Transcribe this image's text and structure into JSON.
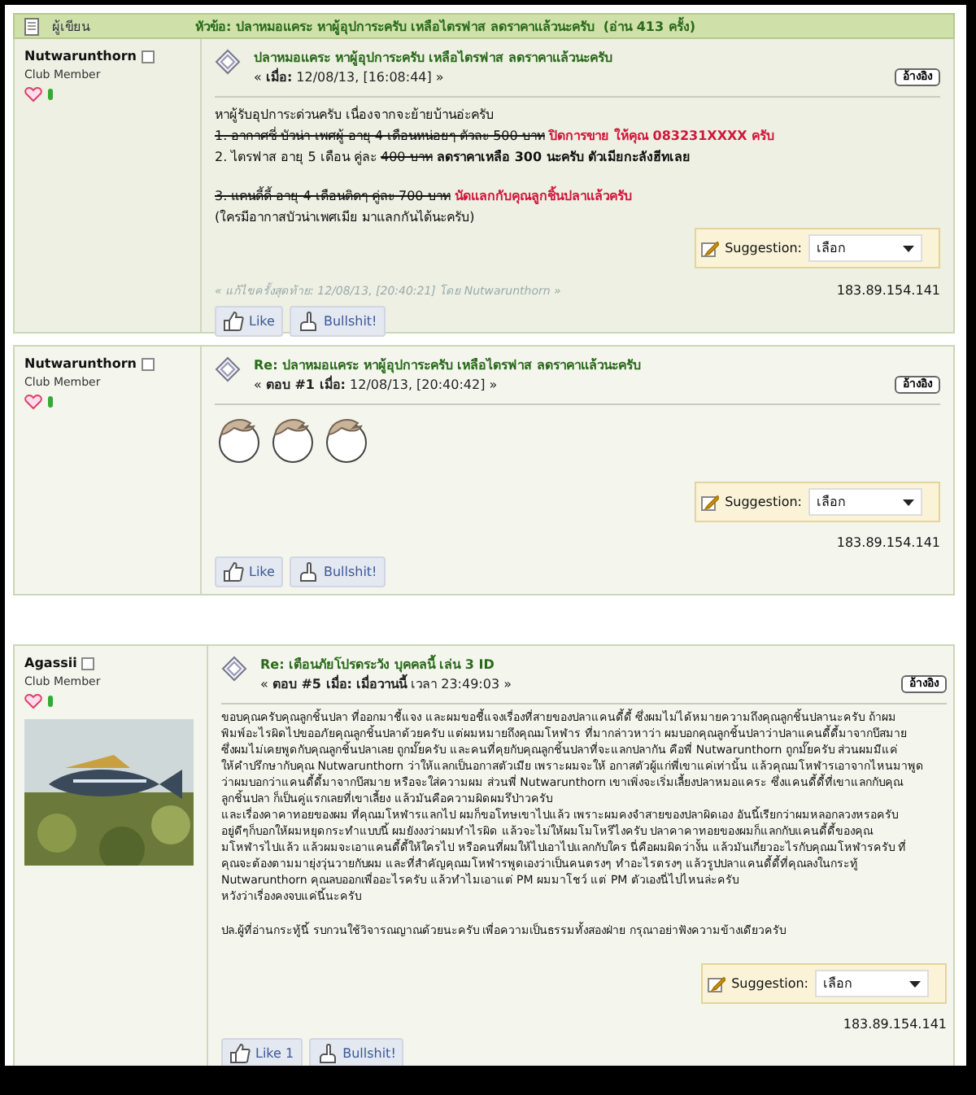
{
  "header": {
    "author_label": "ผู้เขียน",
    "topic": "หัวข้อ: ปลาหมอแคระ หาผู้อุปการะครับ เหลือไตรฟาส ลดราคาแล้วนะครับ  (อ่าน 413 ครั้ง)"
  },
  "posts": [
    {
      "author": "Nutwarunthorn",
      "rank": "Club Member",
      "title": "ปลาหมอแคระ หาผู้อุปการะครับ เหลือไตรฟาส ลดราคาแล้วนะครับ",
      "meta": "« **เมื่อ:** 12/08/13, [16:08:44] »",
      "quote_button": "อ้างอิง",
      "body": [
        {
          "kind": "text",
          "segments": [
            {
              "text": "หาผู้รับอุปการะด่วนครับ เนื่องจากจะย้ายบ้านอ่ะครับ",
              "kind": "plain"
            }
          ]
        },
        {
          "kind": "text",
          "segments": [
            {
              "text": "1. อากาศซี่ บัวน่า เพศผู้ อายุ 4 เดือนหน่อยๆ ตัวละ 500 บาท",
              "kind": "strike"
            },
            {
              "text": " ปิดการขาย ให้คุณ 083231XXXX ครับ",
              "kind": "red"
            }
          ]
        },
        {
          "kind": "text",
          "segments": [
            {
              "text": "2. ไตรฟาส อายุ 5 เดือน คู่ละ ",
              "kind": "plain"
            },
            {
              "text": "400 บาท",
              "kind": "strike"
            },
            {
              "text": " ลดราคาเหลือ 300 นะครับ ตัวเมียกะลังฮีทเลย",
              "kind": "bold"
            }
          ]
        },
        {
          "kind": "blank"
        },
        {
          "kind": "text",
          "segments": [
            {
              "text": "3. แคนดี้ดี้ อายุ 4 เดือนติดๆ คู่ละ 700 บาท",
              "kind": "strike"
            },
            {
              "text": " นัดแลกกับคุณลูกชิ้นปลาแล้วครับ",
              "kind": "red"
            }
          ]
        },
        {
          "kind": "text",
          "segments": [
            {
              "text": "(ใครมีอากาสบัวน่าเพศเมีย มาแลกกันได้นะครับ)",
              "kind": "plain"
            }
          ]
        }
      ],
      "suggestion": {
        "label": "Suggestion:",
        "value": "เลือก"
      },
      "ip": "183.89.154.141",
      "edit_note": "« แก้ไขครั้งสุดท้าย: 12/08/13, [20:40:21] โดย Nutwarunthorn »",
      "buttons": [
        {
          "kind": "like",
          "label": "Like"
        },
        {
          "kind": "bullshit",
          "label": "Bullshit!"
        }
      ]
    },
    {
      "author": "Nutwarunthorn",
      "rank": "Club Member",
      "title": "Re: ปลาหมอแคระ หาผู้อุปการะครับ เหลือไตรฟาส ลดราคาแล้วนะครับ",
      "meta": "« **ตอบ #1 เมื่อ:** 12/08/13, [20:40:42] »",
      "quote_button": "อ้างอิง",
      "body": [
        {
          "kind": "emoticon"
        },
        {
          "kind": "emoticon"
        },
        {
          "kind": "emoticon"
        }
      ],
      "suggestion": {
        "label": "Suggestion:",
        "value": "เลือก"
      },
      "ip": "183.89.154.141",
      "buttons": [
        {
          "kind": "like",
          "label": "Like"
        },
        {
          "kind": "bullshit",
          "label": "Bullshit!"
        }
      ]
    },
    {
      "author": "Agassii",
      "rank": "Club Member",
      "avatar": {
        "kind": "picture"
      },
      "title": "Re: เตือนภัยโปรดระวัง บุคคลนี้ เล่น 3 ID",
      "meta": "« **ตอบ #5 เมื่อ:** **เมื่อวานนี้** เวลา 23:49:03 »",
      "quote_button": "อ้างอิง",
      "body": [
        {
          "kind": "text",
          "segments": [
            {
              "text": "ขอบคุณครับคุณลูกชิ้นปลา ที่ออกมาชี้แจง และผมขอชี้แจงเรื่องที่สายของปลาแคนดี้ดี้ ซึ่งผมไม่ได้หมายความถึงคุณลูกชิ้นปลานะครับ ถ้าผม",
              "kind": "plain"
            }
          ]
        },
        {
          "kind": "text",
          "segments": [
            {
              "text": "พิมพ์อะไรผิดไปขออภัยคุณลูกชิ้นปลาด้วยครับ แต่ผมหมายถึงคุณมโหฬาร ที่มากล่าวหาว่า ผมบอกคุณลูกชิ้นปลาว่าปลาแคนดี้ดี้มาจากบึสมาย",
              "kind": "plain"
            }
          ]
        },
        {
          "kind": "text",
          "segments": [
            {
              "text": "ซึ่งผมไม่เคยพูดกับคุณลูกชิ้นปลาเลย ถูกมั๊ยครับ และคนที่คุยกับคุณลูกชิ้นปลาที่จะแลกปลากัน คือพี่ Nutwarunthorn ถูกมั๊ยครับ ส่วนผมมีแค่",
              "kind": "plain"
            }
          ]
        },
        {
          "kind": "text",
          "segments": [
            {
              "text": "ให้คำปรึกษากับคุณ Nutwarunthorn ว่าให้แลกเป็นอกาสตัวเมีย เพราะผมจะให้ อกาสตัวผู้แก่พี่เขาแค่เท่านั้น แล้วคุณมโหฬารเอาจากไหนมาพูด",
              "kind": "plain"
            }
          ]
        },
        {
          "kind": "text",
          "segments": [
            {
              "text": "ว่าผมบอกว่าแคนดี้ดี้มาจากบึสมาย หรือจะใส่ความผม ส่วนพี่ Nutwarunthorn เขาเพิ่งจะเริ่มเลี้ยงปลาหมอแคระ ซึ่งแคนดี้ดี้ที่เขาแลกกับคุณ",
              "kind": "plain"
            }
          ]
        },
        {
          "kind": "text",
          "segments": [
            {
              "text": "ลูกชิ้นปลา ก็เป็นคู่แรกเลยที่เขาเลี้ยง แล้วมันคือความผิดผมรึป่าวครับ",
              "kind": "plain"
            }
          ]
        },
        {
          "kind": "text",
          "segments": [
            {
              "text": "และเรื่องคาคาทอยของผม ที่คุณมโหฬารแลกไป ผมก็ขอโทษเขาไปแล้ว เพราะผมคงจำสายของปลาผิดเอง อันนี้เรียกว่าผมหลอกลวงหรอครับ",
              "kind": "plain"
            }
          ]
        },
        {
          "kind": "text",
          "segments": [
            {
              "text": "อยู่ดีๆก็บอกให้ผมหยุดกระทำแบบนี้ ผมยังงงว่าผมทำไรผิด แล้วจะไม่ให้ผมโมโหรึไงครับ ปลาคาคาทอยของผมก็แลกกับแคนดี้ดี้ของคุณ",
              "kind": "plain"
            }
          ]
        },
        {
          "kind": "text",
          "segments": [
            {
              "text": "มโหฬารไปแล้ว แล้วผมจะเอาแคนดี้ดี้ให้ใครไป หรือคนที่ผมให้ไปเอาไปแลกกับใคร นี่คือผมผิดว่างั้น แล้วมันเกี่ยวอะไรกับคุณมโหฬารครับ ที่",
              "kind": "plain"
            }
          ]
        },
        {
          "kind": "text",
          "segments": [
            {
              "text": "คุณจะต้องตามมายุ่งวุ่นวายกับผม และที่สำคัญคุณมโหฬารพูดเองว่าเป็นคนตรงๆ ทำอะไรตรงๆ แล้วรูปปลาแคนดี้ดี้ที่คุณลงในกระทู้",
              "kind": "plain"
            }
          ]
        },
        {
          "kind": "text",
          "segments": [
            {
              "text": "Nutwarunthorn คุณลบออกเพื่ออะไรครับ แล้วทำไมเอาแต่ PM ผมมาโชว์ แต่ PM ตัวเองนี่ไปไหนล่ะครับ",
              "kind": "plain"
            }
          ]
        },
        {
          "kind": "text",
          "segments": [
            {
              "text": "หวังว่าเรื่องคงจบแค่นี้นะครับ",
              "kind": "plain"
            }
          ]
        },
        {
          "kind": "blank"
        },
        {
          "kind": "text",
          "segments": [
            {
              "text": "ปล.ผู้ที่อ่านกระทู้นี้ รบกวนใช้วิจารณญาณด้วยนะครับ เพื่อความเป็นธรรมทั้งสองฝ่าย กรุณาอย่าฟังความข้างเดียวครับ",
              "kind": "plain"
            }
          ]
        }
      ],
      "suggestion": {
        "label": "Suggestion:",
        "value": "เลือก"
      },
      "ip": "183.89.154.141",
      "buttons": [
        {
          "kind": "like",
          "label": "Like 1"
        },
        {
          "kind": "bullshit",
          "label": "Bullshit!"
        }
      ]
    }
  ]
}
